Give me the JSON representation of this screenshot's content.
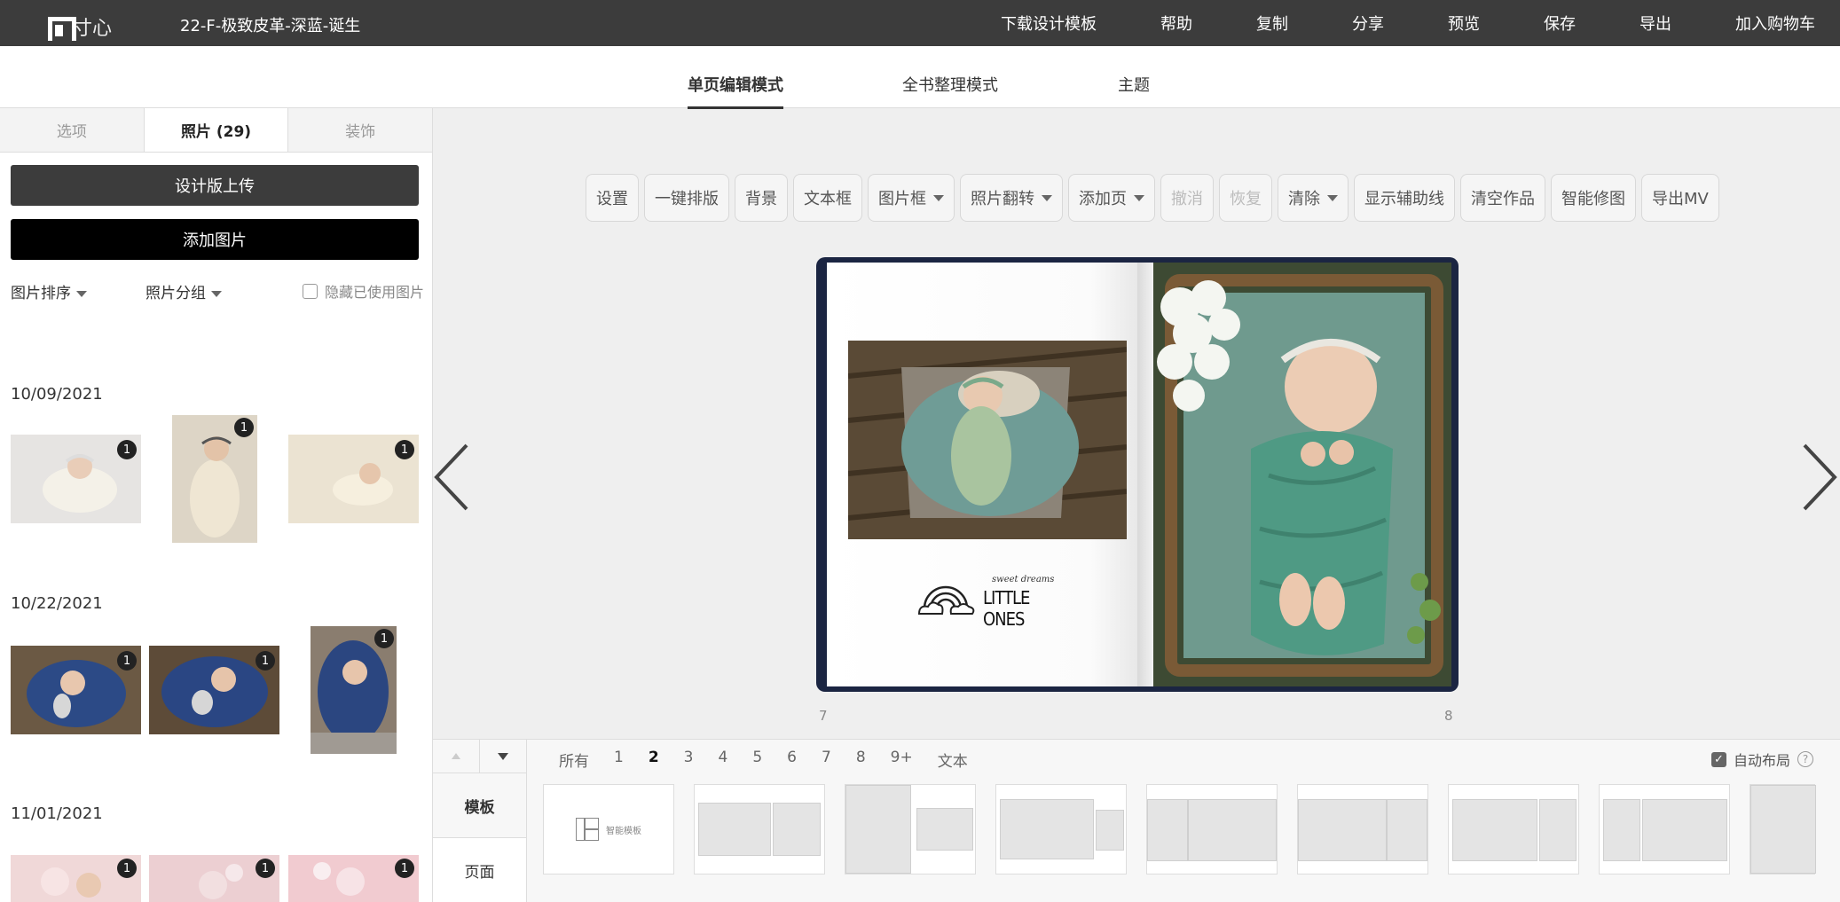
{
  "app": {
    "logo_text": "寸心",
    "document_title": "22-F-极致皮革-深蓝-诞生"
  },
  "topnav": [
    "下载设计模板",
    "帮助",
    "复制",
    "分享",
    "预览",
    "保存",
    "导出",
    "加入购物车"
  ],
  "mode_tabs": {
    "single": "单页编辑模式",
    "whole": "全书整理模式",
    "theme": "主题",
    "active": "single"
  },
  "sidebar": {
    "tabs": {
      "options": "选项",
      "photos": "照片 (29)",
      "decor": "装饰"
    },
    "upload_button": "设计版上传",
    "add_button": "添加图片",
    "sort_label": "图片排序",
    "group_label": "照片分组",
    "hide_used_label": "隐藏已使用图片",
    "groups": [
      {
        "date": "10/09/2021",
        "badges": [
          "1",
          "1",
          "1"
        ]
      },
      {
        "date": "10/22/2021",
        "badges": [
          "1",
          "1",
          "1"
        ]
      },
      {
        "date": "11/01/2021",
        "badges": [
          "1",
          "1",
          "1"
        ]
      }
    ]
  },
  "toolbar": [
    {
      "label": "设置",
      "dropdown": false,
      "disabled": false
    },
    {
      "label": "一键排版",
      "dropdown": false,
      "disabled": false
    },
    {
      "label": "背景",
      "dropdown": false,
      "disabled": false
    },
    {
      "label": "文本框",
      "dropdown": false,
      "disabled": false
    },
    {
      "label": "图片框",
      "dropdown": true,
      "disabled": false
    },
    {
      "label": "照片翻转",
      "dropdown": true,
      "disabled": false
    },
    {
      "label": "添加页",
      "dropdown": true,
      "disabled": false
    },
    {
      "label": "撤消",
      "dropdown": false,
      "disabled": true
    },
    {
      "label": "恢复",
      "dropdown": false,
      "disabled": true
    },
    {
      "label": "清除",
      "dropdown": true,
      "disabled": false
    },
    {
      "label": "显示辅助线",
      "dropdown": false,
      "disabled": false
    },
    {
      "label": "清空作品",
      "dropdown": false,
      "disabled": false
    },
    {
      "label": "智能修图",
      "dropdown": false,
      "disabled": false
    },
    {
      "label": "导出MV",
      "dropdown": false,
      "disabled": false
    }
  ],
  "spread": {
    "left_page_number": "7",
    "right_page_number": "8",
    "stamp_script": "sweet dreams",
    "stamp_text": "LITTLE ONES"
  },
  "bottom": {
    "page_filters": [
      "所有",
      "1",
      "2",
      "3",
      "4",
      "5",
      "6",
      "7",
      "8",
      "9+",
      "文本"
    ],
    "active_filter": "2",
    "auto_layout_label": "自动布局",
    "help_glyph": "?",
    "side_list": {
      "templates": "模板",
      "pages": "页面"
    },
    "smart_template_label": "智能模板"
  },
  "colors": {
    "topbar": "#3c3c3c",
    "book_cover": "#1b2542",
    "accent": "#000000"
  }
}
